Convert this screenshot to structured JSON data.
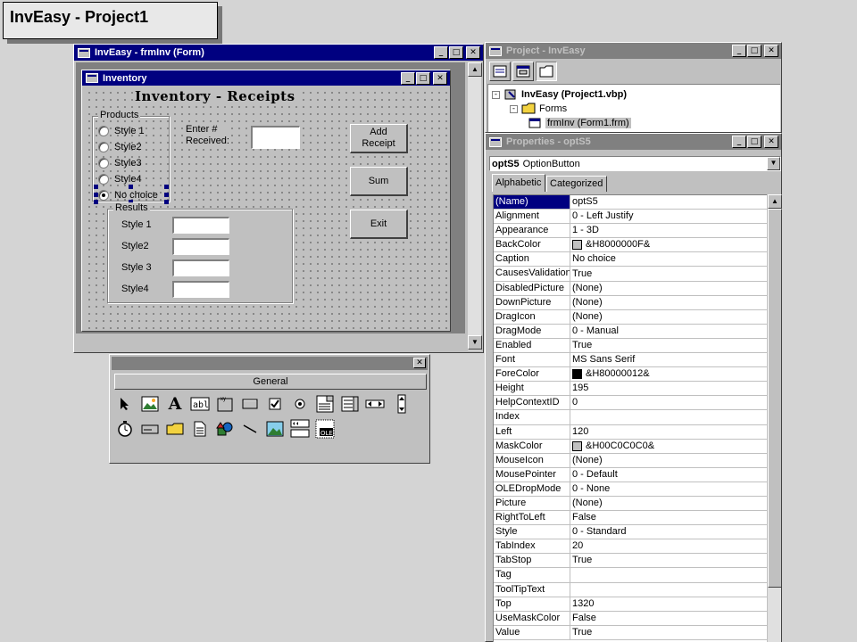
{
  "slide_title": "InvEasy - Project1",
  "form_window": {
    "title": "InvEasy - frmInv (Form)",
    "inner_title": "Inventory",
    "heading": "Inventory - Receipts",
    "products_label": "Products",
    "products": [
      "Style 1",
      "Style2",
      "Style3",
      "Style4",
      "No choice"
    ],
    "enter_label_1": "Enter #",
    "enter_label_2": "Received:",
    "results_label": "Results",
    "results": [
      "Style 1",
      "Style2",
      "Style 3",
      "Style4"
    ],
    "add_btn_1": "Add",
    "add_btn_2": "Receipt",
    "sum_btn": "Sum",
    "exit_btn": "Exit"
  },
  "toolbox": {
    "tab": "General"
  },
  "project_window": {
    "title": "Project - InvEasy",
    "root": "InvEasy (Project1.vbp)",
    "folder": "Forms",
    "item": "frmInv (Form1.frm)"
  },
  "properties_window": {
    "title": "Properties - optS5",
    "object_name": "optS5",
    "object_type": "OptionButton",
    "tab_alpha": "Alphabetic",
    "tab_cat": "Categorized",
    "rows": [
      {
        "name": "(Name)",
        "value": "optS5"
      },
      {
        "name": "Alignment",
        "value": "0 - Left Justify"
      },
      {
        "name": "Appearance",
        "value": "1 - 3D"
      },
      {
        "name": "BackColor",
        "value": "&H8000000F&",
        "swatch": "#c0c0c0"
      },
      {
        "name": "Caption",
        "value": "No choice"
      },
      {
        "name": "CausesValidation",
        "value": "True"
      },
      {
        "name": "DisabledPicture",
        "value": "(None)"
      },
      {
        "name": "DownPicture",
        "value": "(None)"
      },
      {
        "name": "DragIcon",
        "value": "(None)"
      },
      {
        "name": "DragMode",
        "value": "0 - Manual"
      },
      {
        "name": "Enabled",
        "value": "True"
      },
      {
        "name": "Font",
        "value": "MS Sans Serif"
      },
      {
        "name": "ForeColor",
        "value": "&H80000012&",
        "swatch": "#000000"
      },
      {
        "name": "Height",
        "value": "195"
      },
      {
        "name": "HelpContextID",
        "value": "0"
      },
      {
        "name": "Index",
        "value": ""
      },
      {
        "name": "Left",
        "value": "120"
      },
      {
        "name": "MaskColor",
        "value": "&H00C0C0C0&",
        "swatch": "#c0c0c0"
      },
      {
        "name": "MouseIcon",
        "value": "(None)"
      },
      {
        "name": "MousePointer",
        "value": "0 - Default"
      },
      {
        "name": "OLEDropMode",
        "value": "0 - None"
      },
      {
        "name": "Picture",
        "value": "(None)"
      },
      {
        "name": "RightToLeft",
        "value": "False"
      },
      {
        "name": "Style",
        "value": "0 - Standard"
      },
      {
        "name": "TabIndex",
        "value": "20"
      },
      {
        "name": "TabStop",
        "value": "True"
      },
      {
        "name": "Tag",
        "value": ""
      },
      {
        "name": "ToolTipText",
        "value": ""
      },
      {
        "name": "Top",
        "value": "1320"
      },
      {
        "name": "UseMaskColor",
        "value": "False"
      },
      {
        "name": "Value",
        "value": "True"
      }
    ]
  },
  "colors": {
    "title_active": "#000080",
    "title_inactive": "#808080",
    "face": "#c0c0c0"
  }
}
